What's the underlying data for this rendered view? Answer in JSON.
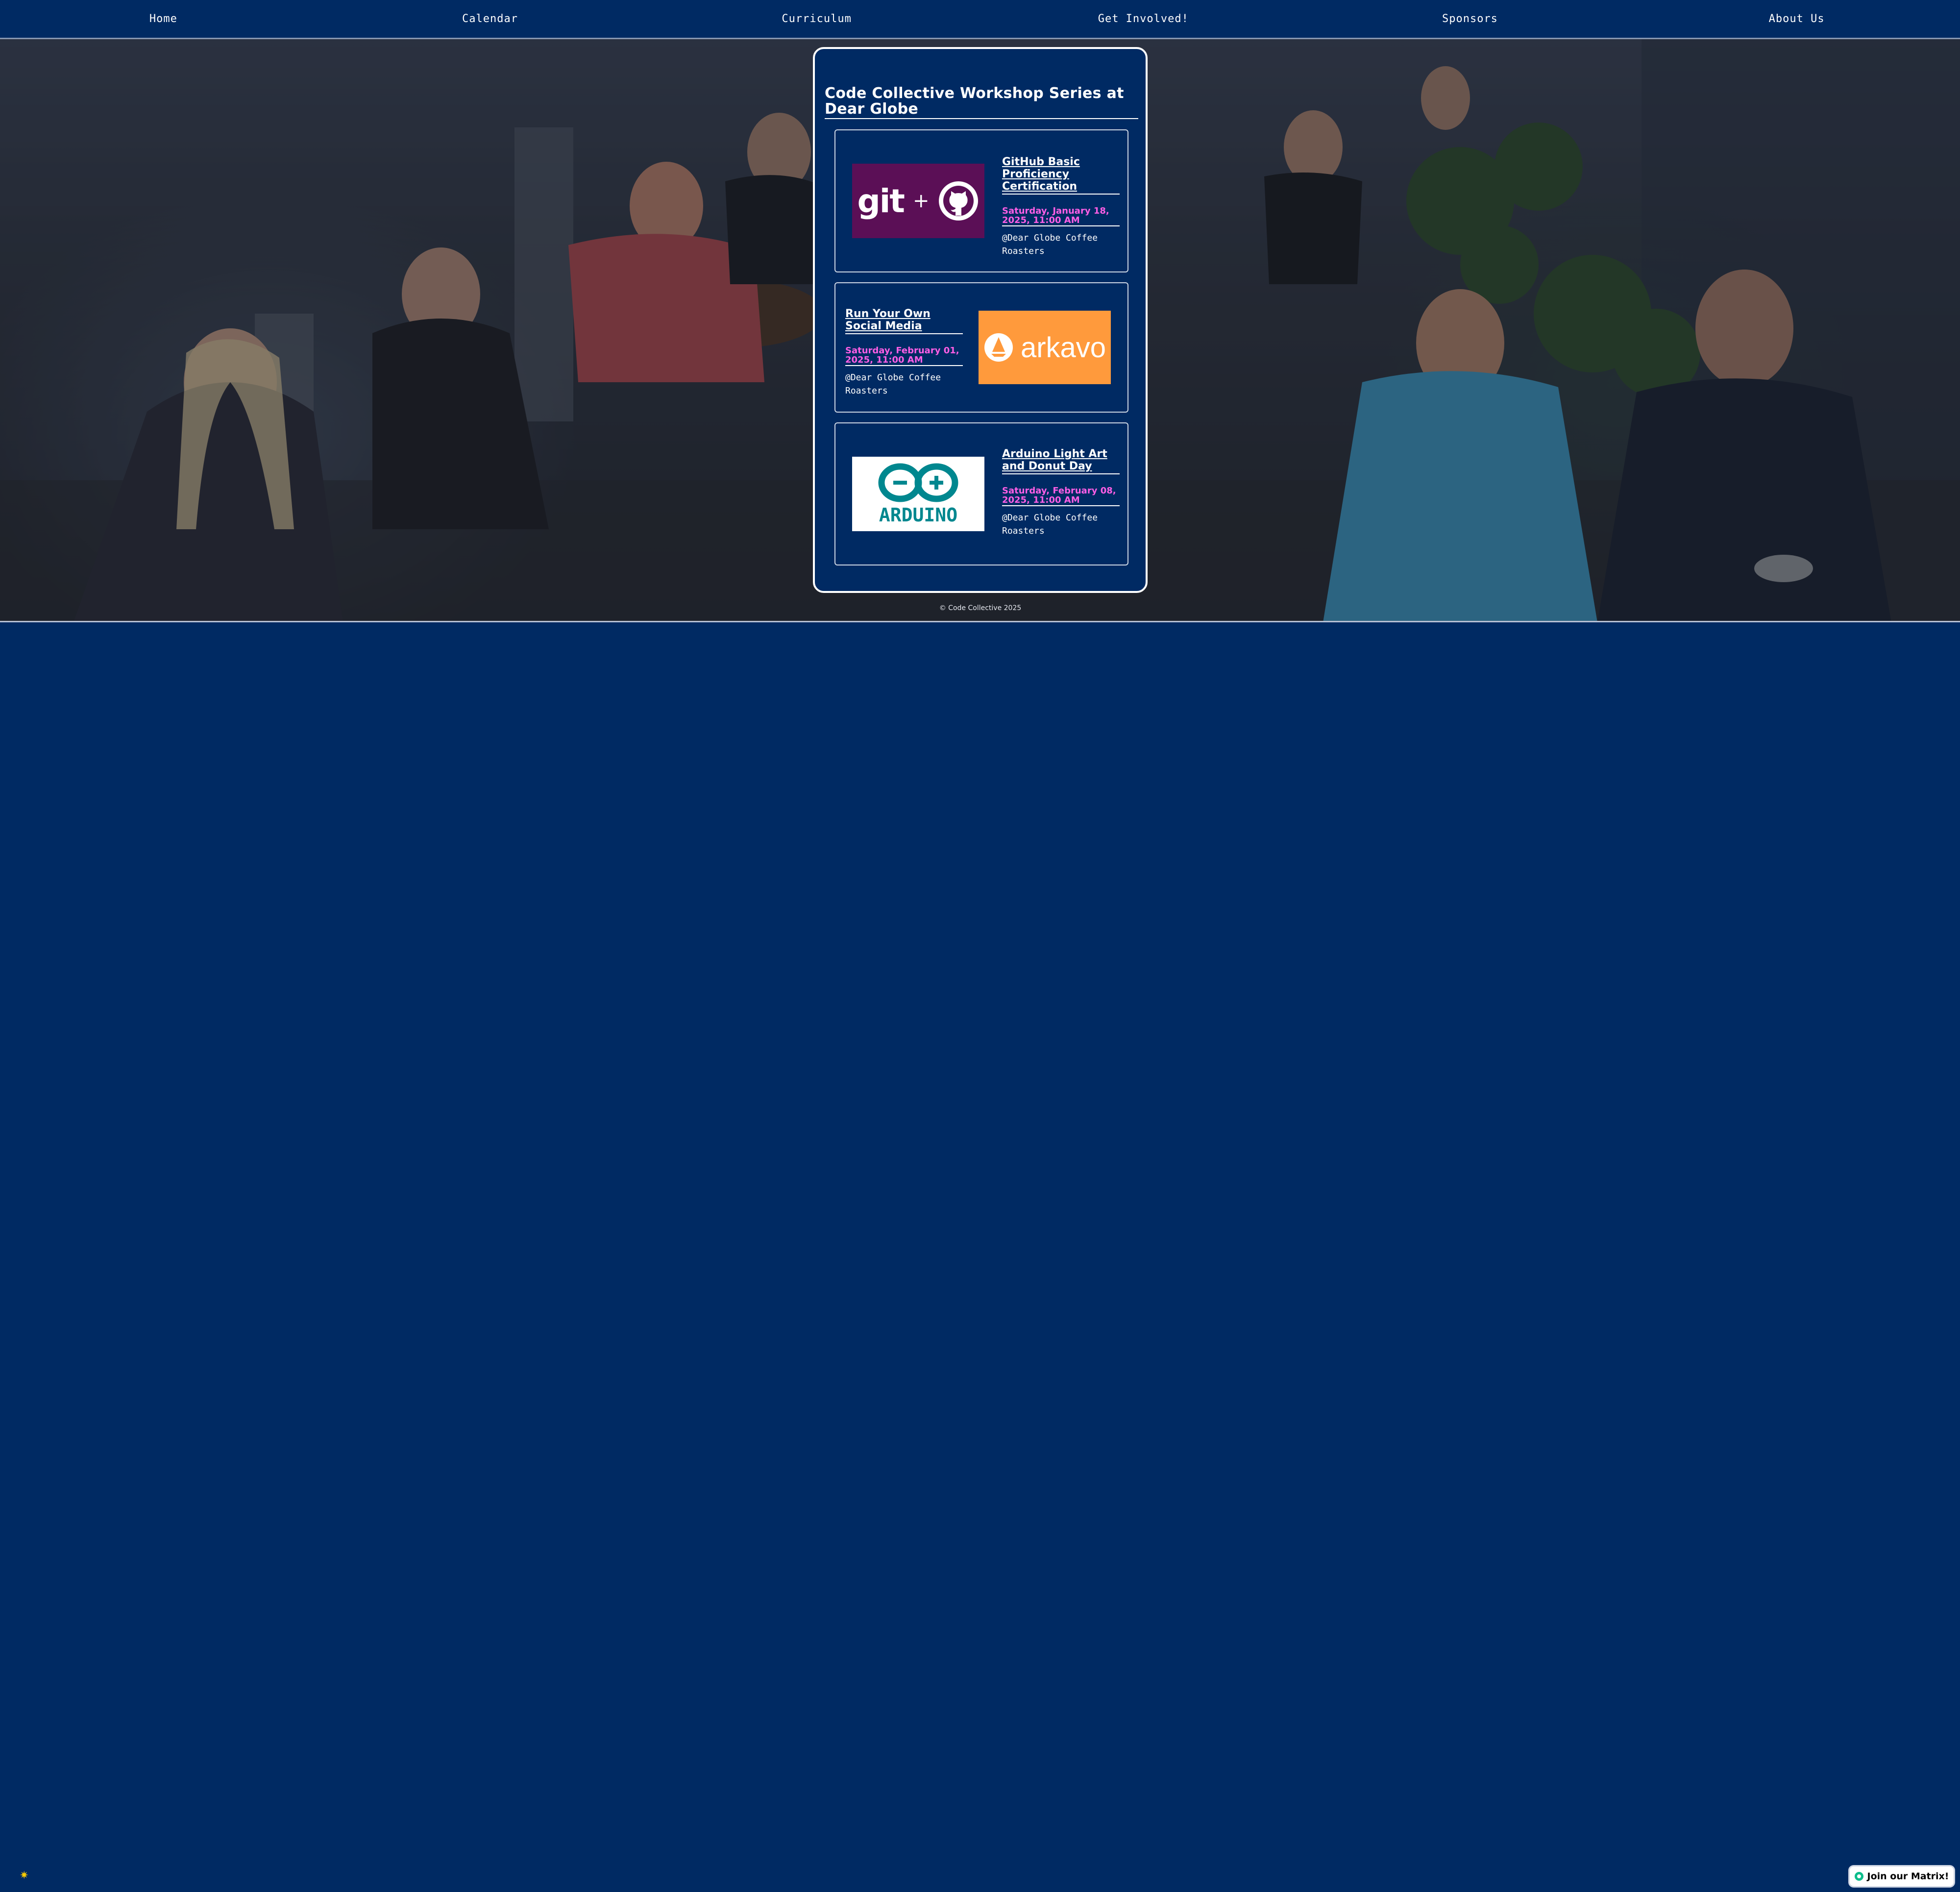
{
  "nav": {
    "items": [
      "Home",
      "Calendar",
      "Curriculum",
      "Get Involved!",
      "Sponsors",
      "About Us"
    ]
  },
  "panel": {
    "title": "Code Collective Workshop Series at Dear Globe"
  },
  "events": [
    {
      "title": "GitHub Basic Proficiency Certification",
      "date": "Saturday, January 18, 2025, 11:00 AM",
      "location": "@Dear Globe Coffee Roasters",
      "logo_text": "git",
      "logo_icon": "github-icon",
      "logo_bg": "#5b0f56"
    },
    {
      "title": "Run Your Own Social Media",
      "date": "Saturday, February 01, 2025, 11:00 AM",
      "location": "@Dear Globe Coffee Roasters",
      "logo_text": "arkavo",
      "logo_icon": "sailboat-icon",
      "logo_bg": "#ff9a3c"
    },
    {
      "title": "Arduino Light Art and Donut Day",
      "date": "Saturday, February 08, 2025, 11:00 AM",
      "location": "@Dear Globe Coffee Roasters",
      "logo_text": "ARDUINO",
      "logo_icon": "infinity-icon",
      "logo_bg": "#ffffff"
    }
  ],
  "footer": {
    "copyright": "© Code Collective 2025"
  },
  "widget": {
    "label": "Join our Matrix!",
    "icon": "matrix-icon"
  },
  "colors": {
    "page_bg": "#002a63",
    "accent_date": "#ff5ee6"
  }
}
